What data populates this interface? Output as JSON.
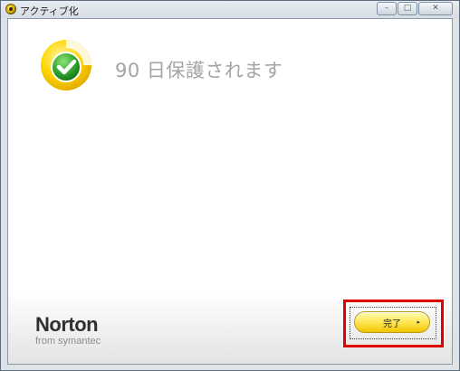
{
  "window": {
    "title": "アクティブ化",
    "controls": {
      "minimize": "–",
      "maximize": "□",
      "close": "✕"
    }
  },
  "main": {
    "headline": "90 日保護されます",
    "status_icon": "check-shield-icon"
  },
  "logo": {
    "brand": "Norton",
    "tagline": "from symantec"
  },
  "actions": {
    "done_label": "完了",
    "done_arrow": "▸"
  },
  "colors": {
    "accent_yellow": "#ffd600",
    "check_green": "#2ea42a",
    "highlight_red": "#e00000",
    "headline_gray": "#a4a4a4"
  }
}
